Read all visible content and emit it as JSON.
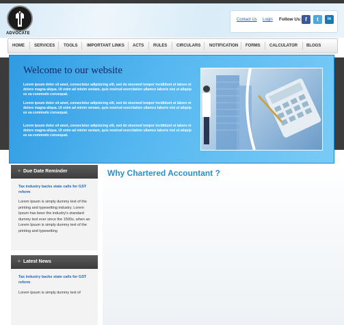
{
  "brand": {
    "logo_text": "ADVOCATE"
  },
  "header": {
    "contact_label": "Contact Us",
    "login_label": "Login",
    "follow_label": "Follow Us:",
    "social": [
      {
        "icon": "facebook-icon",
        "glyph": "f",
        "color": "#3b5998"
      },
      {
        "icon": "twitter-icon",
        "glyph": "t",
        "color": "#4fa7dd"
      },
      {
        "icon": "linkedin-icon",
        "glyph": "in",
        "color": "#1e75b0"
      }
    ]
  },
  "nav": {
    "items": [
      "HOME",
      "SERVICES",
      "TOOLS",
      "IMPORTANT LINKS",
      "ACTS",
      "RULES",
      "CIRCULARS",
      "NOTIFICATION",
      "FORMS",
      "CALCULATOR",
      "BLOGS"
    ]
  },
  "hero": {
    "title": "Welcome to our website",
    "paragraphs": [
      "Lorem ipsum dolor sit amet, consectetur adipisicing elit, sed do eiusmod tempor incididunt ut labore et dolore magna aliqua. Ut enim ad minim veniam, quis nostrud exercitation ullamco laboris nisi ut aliquip ex ea commodo consequat.",
      "Lorem ipsum dolor sit amet, consectetur adipisicing elit, sed do eiusmod tempor incididunt ut labore et dolore magna aliqua. Ut enim ad minim veniam, quis nostrud exercitation ullamco laboris nisi ut aliquip ex ea commodo consequat.",
      "Lorem ipsum dolor sit amet, consectetur adipisicing elit, sed do eiusmod tempor incididunt ut labore et dolore magna aliqua. Ut enim ad minim veniam, quis nostrud exercitation ullamco laboris nisi ut aliquip ex ea commodo consequat."
    ]
  },
  "sidebar": {
    "due_date": {
      "title": "Due Date Reminder",
      "link": "Tax industry backs state calls for GST reform",
      "text": "Lorem Ipsum is simply dummy text of the printing and typesetting industry. Lorem Ipsum has been the industry's standard dummy text ever since the 1500s, when an Lorem Ipsum is simply dummy text of the printing and typesetting"
    },
    "latest_news": {
      "title": "Latest News",
      "link": "Tax industry backs state calls for GST reform",
      "text": "Lorem Ipsum is simply dummy text of"
    }
  },
  "main": {
    "title": "Why Chartered Accountant ?"
  }
}
